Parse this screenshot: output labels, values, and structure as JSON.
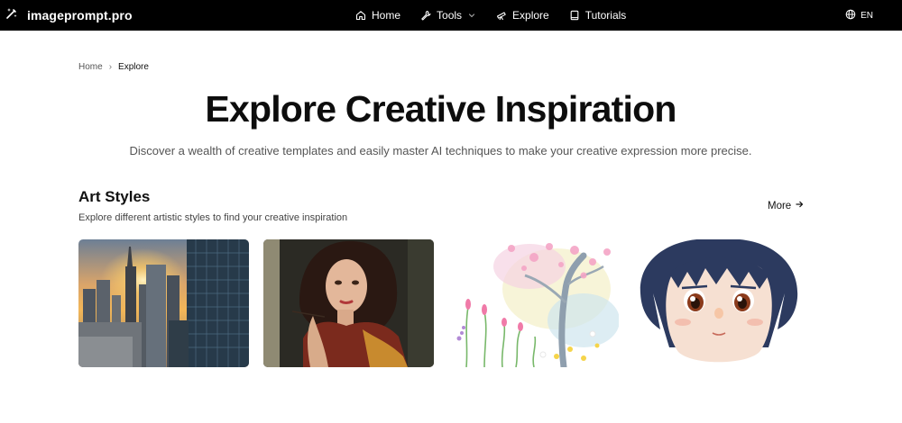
{
  "header": {
    "brand": "imageprompt.pro",
    "nav": [
      {
        "label": "Home",
        "icon": "home-icon"
      },
      {
        "label": "Tools",
        "icon": "wrench-icon"
      },
      {
        "label": "Explore",
        "icon": "telescope-icon"
      },
      {
        "label": "Tutorials",
        "icon": "book-icon"
      }
    ],
    "language": "EN"
  },
  "breadcrumb": {
    "home": "Home",
    "separator": "›",
    "current": "Explore"
  },
  "hero": {
    "title": "Explore Creative Inspiration",
    "subtitle": "Discover a wealth of creative templates and easily master AI techniques to make your creative expression more precise."
  },
  "section": {
    "title": "Art Styles",
    "description": "Explore different artistic styles to find your creative inspiration",
    "more_label": "More"
  },
  "cards": [
    {
      "image": "city-skyline-sunset-photo"
    },
    {
      "image": "woman-oil-painting-portrait"
    },
    {
      "image": "watercolor-spring-tree-flowers"
    },
    {
      "image": "anime-girl-portrait"
    }
  ]
}
